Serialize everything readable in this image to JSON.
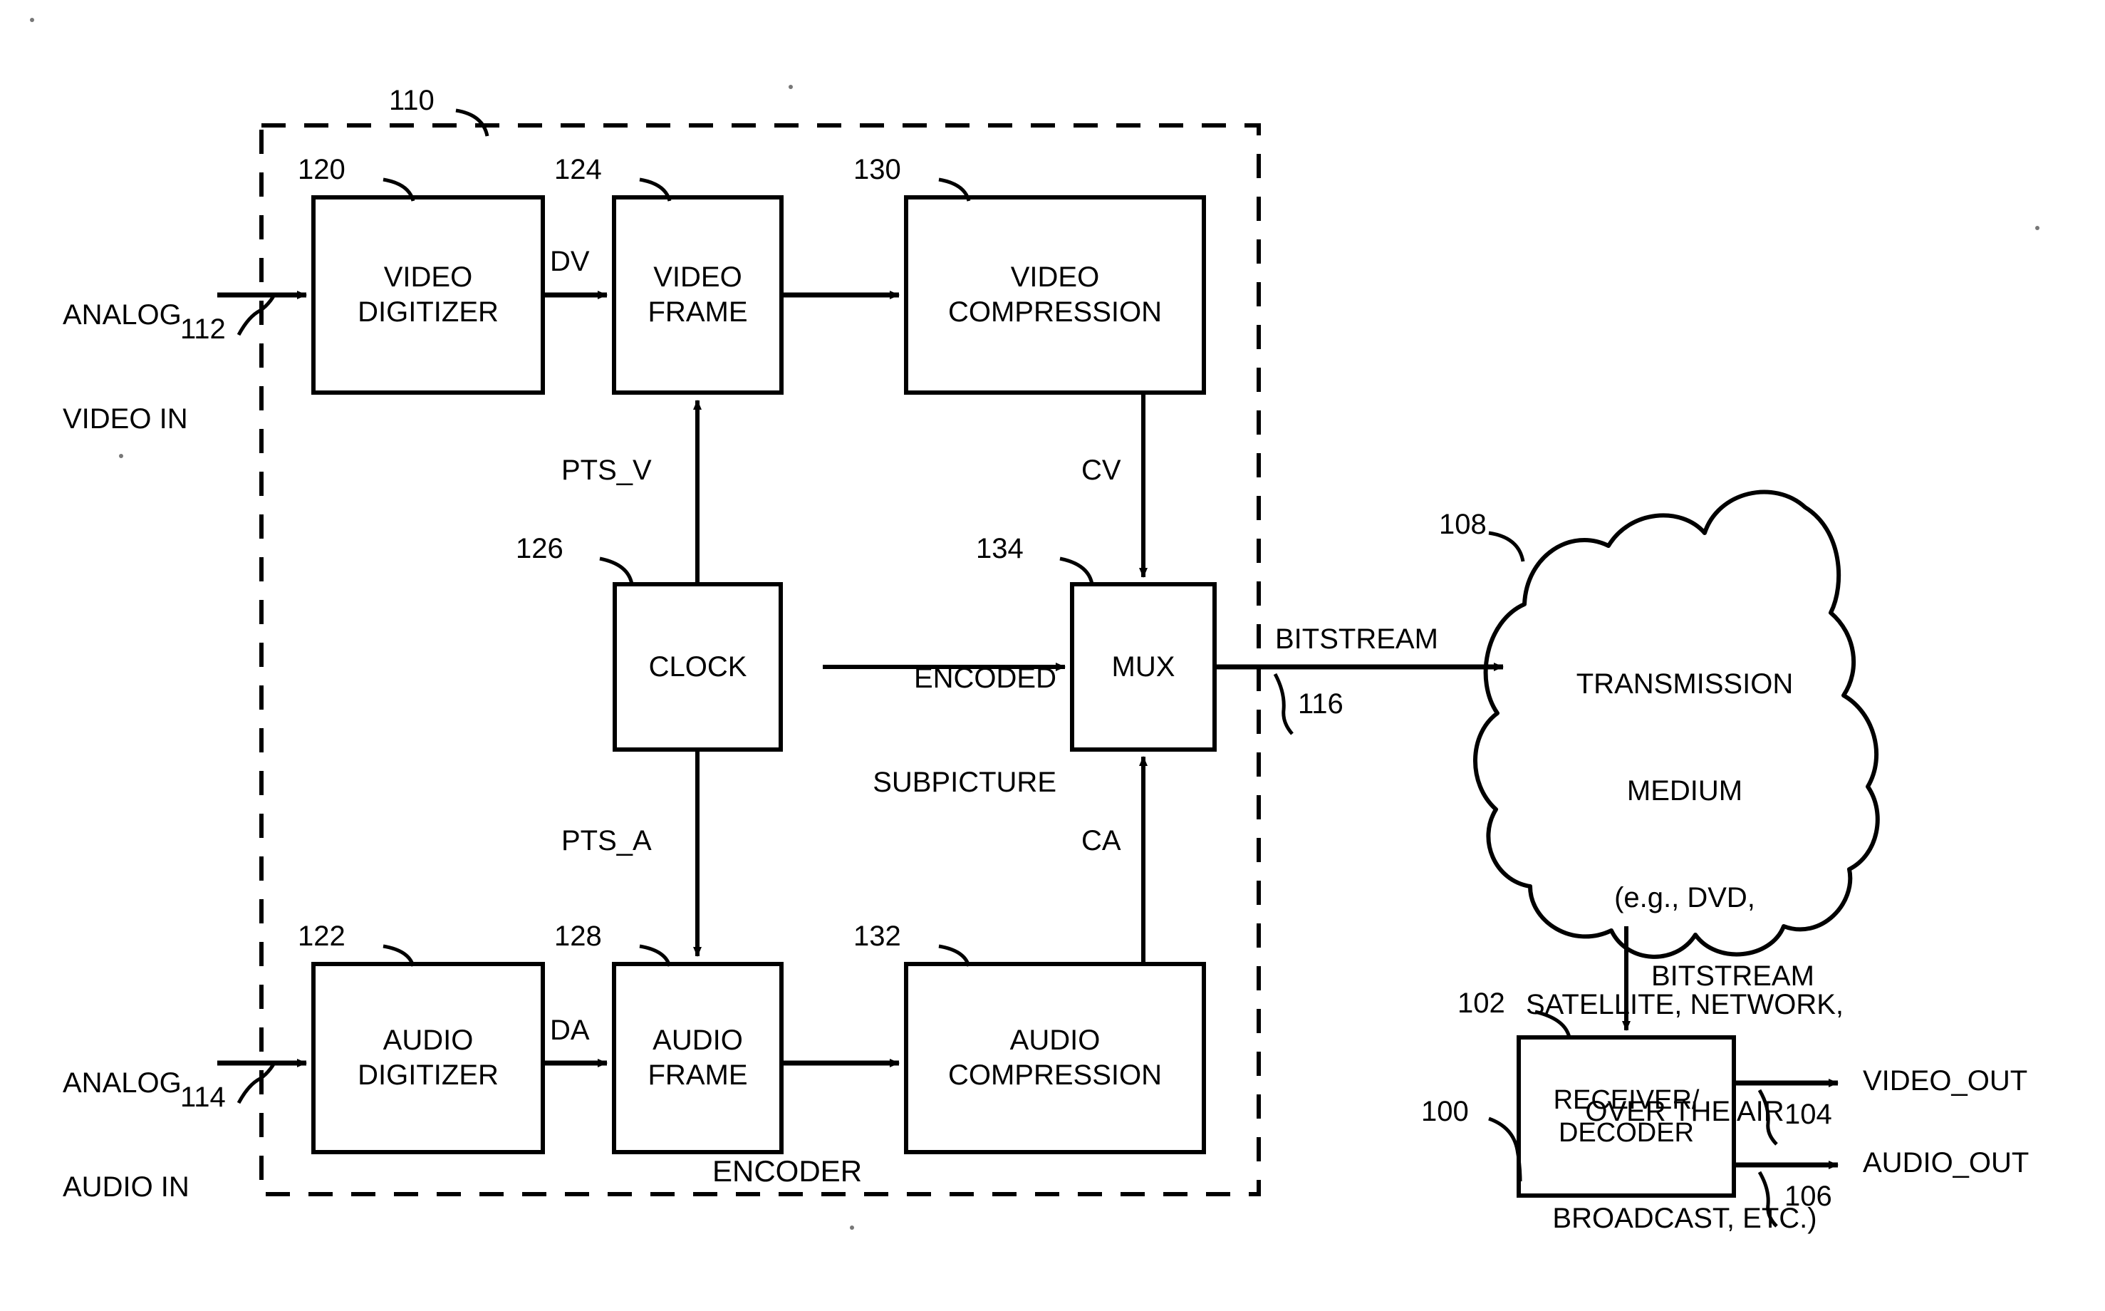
{
  "figure": {
    "type": "patent-block-diagram",
    "encoder_group_label": "ENCODER",
    "blocks": [
      {
        "id": "video_digitizer",
        "label": "VIDEO\nDIGITIZER",
        "ref": "120"
      },
      {
        "id": "video_frame",
        "label": "VIDEO\nFRAME",
        "ref": "124"
      },
      {
        "id": "video_compression",
        "label": "VIDEO\nCOMPRESSION",
        "ref": "130"
      },
      {
        "id": "clock",
        "label": "CLOCK",
        "ref": "126"
      },
      {
        "id": "mux",
        "label": "MUX",
        "ref": "134"
      },
      {
        "id": "audio_digitizer",
        "label": "AUDIO\nDIGITIZER",
        "ref": "122"
      },
      {
        "id": "audio_frame",
        "label": "AUDIO\nFRAME",
        "ref": "128"
      },
      {
        "id": "audio_compression",
        "label": "AUDIO\nCOMPRESSION",
        "ref": "132"
      },
      {
        "id": "receiver_decoder",
        "label": "RECEIVER/\nDECODER",
        "ref": "102"
      }
    ],
    "cloud": {
      "ref": "108",
      "lines": [
        "TRANSMISSION",
        "MEDIUM",
        "(e.g., DVD,",
        "SATELLITE, NETWORK,",
        "OVER THE AIR",
        "BROADCAST, ETC.)"
      ]
    },
    "refs": {
      "encoder_boundary": "110",
      "analog_video_in": "112",
      "analog_audio_in": "114",
      "bitstream_out": "116",
      "system": "100",
      "receiver": "102",
      "video_out": "104",
      "audio_out": "106",
      "transmission_medium": "108"
    },
    "io_labels": {
      "analog_video_in": "ANALOG\nVIDEO IN",
      "analog_video_in_l1": "ANALOG",
      "analog_video_in_l2": "VIDEO IN",
      "analog_audio_in_l1": "ANALOG",
      "analog_audio_in_l2": "AUDIO IN",
      "video_out": "VIDEO_OUT",
      "audio_out": "AUDIO_OUT"
    },
    "signals": {
      "dv": "DV",
      "da": "DA",
      "pts_v": "PTS_V",
      "pts_a": "PTS_A",
      "cv": "CV",
      "ca": "CA",
      "encoded_subpicture_l1": "ENCODED",
      "encoded_subpicture_l2": "SUBPICTURE",
      "bitstream_to_medium": "BITSTREAM",
      "bitstream_to_receiver": "BITSTREAM"
    },
    "colors": {
      "stroke": "#000000",
      "background": "#ffffff"
    }
  }
}
